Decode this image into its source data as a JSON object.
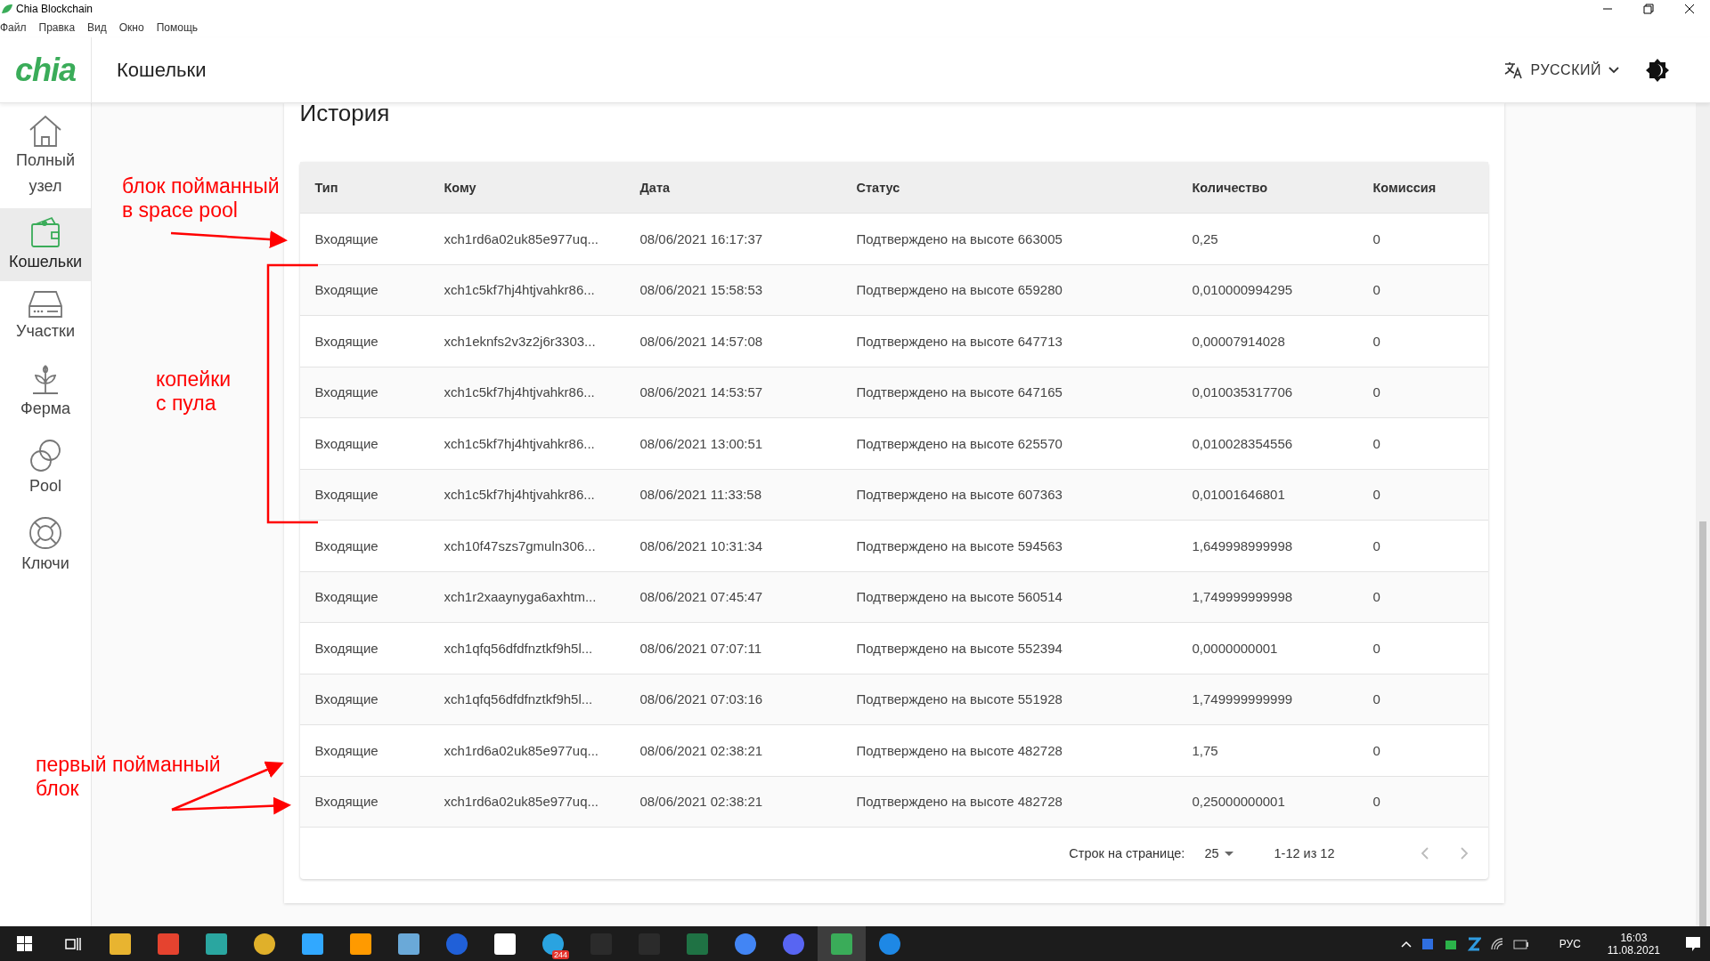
{
  "window": {
    "title": "Chia Blockchain"
  },
  "menu": [
    "Файл",
    "Правка",
    "Вид",
    "Окно",
    "Помощь"
  ],
  "header": {
    "logo": "chia",
    "title": "Кошельки",
    "language": "РУССКИЙ"
  },
  "sidebar": {
    "items": [
      {
        "label": "Полный узел",
        "selected": false
      },
      {
        "label": "Кошельки",
        "selected": true
      },
      {
        "label": "Участки",
        "selected": false
      },
      {
        "label": "Ферма",
        "selected": false
      },
      {
        "label": "Pool",
        "selected": false
      },
      {
        "label": "Ключи",
        "selected": false
      }
    ]
  },
  "history": {
    "title": "История",
    "columns": [
      "Тип",
      "Кому",
      "Дата",
      "Статус",
      "Количество",
      "Комиссия"
    ],
    "rows": [
      [
        "Входящие",
        "xch1rd6a02uk85e977uq...",
        "08/06/2021 16:17:37",
        "Подтверждено на высоте 663005",
        "0,25",
        "0"
      ],
      [
        "Входящие",
        "xch1c5kf7hj4htjvahkr86...",
        "08/06/2021 15:58:53",
        "Подтверждено на высоте 659280",
        "0,010000994295",
        "0"
      ],
      [
        "Входящие",
        "xch1eknfs2v3z2j6r3303...",
        "08/06/2021 14:57:08",
        "Подтверждено на высоте 647713",
        "0,00007914028",
        "0"
      ],
      [
        "Входящие",
        "xch1c5kf7hj4htjvahkr86...",
        "08/06/2021 14:53:57",
        "Подтверждено на высоте 647165",
        "0,010035317706",
        "0"
      ],
      [
        "Входящие",
        "xch1c5kf7hj4htjvahkr86...",
        "08/06/2021 13:00:51",
        "Подтверждено на высоте 625570",
        "0,010028354556",
        "0"
      ],
      [
        "Входящие",
        "xch1c5kf7hj4htjvahkr86...",
        "08/06/2021 11:33:58",
        "Подтверждено на высоте 607363",
        "0,01001646801",
        "0"
      ],
      [
        "Входящие",
        "xch10f47szs7gmuln306...",
        "08/06/2021 10:31:34",
        "Подтверждено на высоте 594563",
        "1,649998999998",
        "0"
      ],
      [
        "Входящие",
        "xch1r2xaaynyga6axhtm...",
        "08/06/2021 07:45:47",
        "Подтверждено на высоте 560514",
        "1,749999999998",
        "0"
      ],
      [
        "Входящие",
        "xch1qfq56dfdfnztkf9h5l...",
        "08/06/2021 07:07:11",
        "Подтверждено на высоте 552394",
        "0,0000000001",
        "0"
      ],
      [
        "Входящие",
        "xch1qfq56dfdfnztkf9h5l...",
        "08/06/2021 07:03:16",
        "Подтверждено на высоте 551928",
        "1,749999999999",
        "0"
      ],
      [
        "Входящие",
        "xch1rd6a02uk85e977uq...",
        "08/06/2021 02:38:21",
        "Подтверждено на высоте 482728",
        "1,75",
        "0"
      ],
      [
        "Входящие",
        "xch1rd6a02uk85e977uq...",
        "08/06/2021 02:38:21",
        "Подтверждено на высоте 482728",
        "0,25000000001",
        "0"
      ]
    ],
    "pagination": {
      "rows_label": "Строк на странице:",
      "rows_per_page": "25",
      "range": "1-12 из 12"
    }
  },
  "annotations": [
    "блок пойманный\nв space pool",
    "копейки\nс пула",
    "первый пойманный\nблок"
  ],
  "taskbar": {
    "badge": "244",
    "language": "РУС",
    "time": "16:03",
    "date": "11.08.2021"
  }
}
